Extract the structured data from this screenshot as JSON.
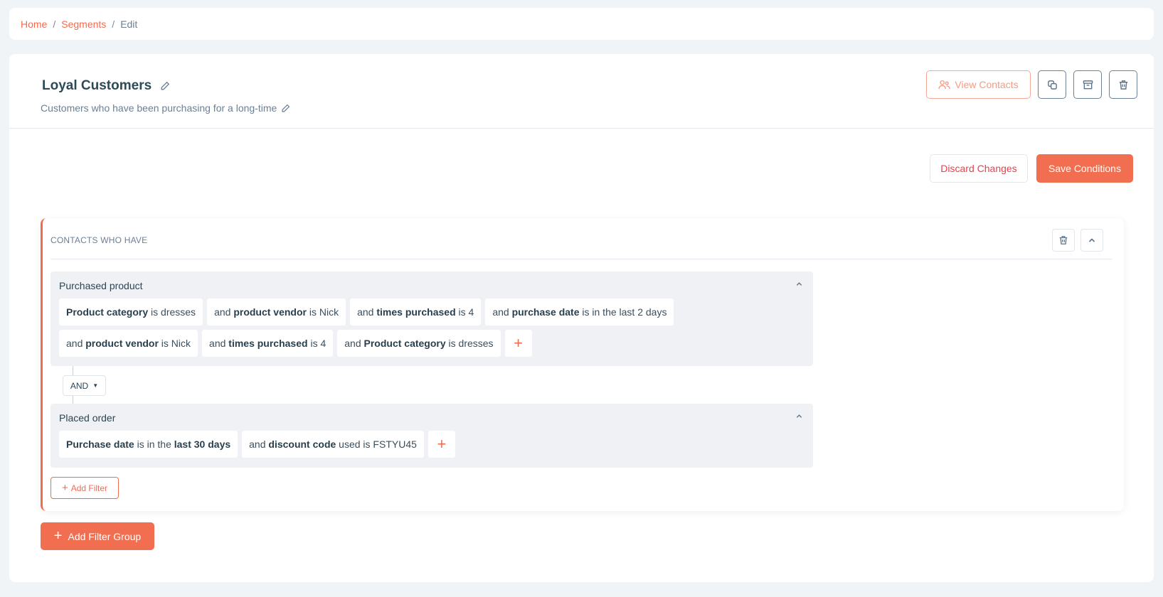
{
  "breadcrumb": [
    {
      "label": "Home"
    },
    {
      "label": "Segments"
    },
    {
      "label": "Edit"
    }
  ],
  "segment": {
    "title": "Loyal Customers",
    "description": "Customers who have been purchasing for a long-time"
  },
  "header_actions": {
    "view_contacts": "View Contacts",
    "icons": [
      "duplicate-icon",
      "archive-icon",
      "trash-icon"
    ]
  },
  "actions": {
    "discard": "Discard Changes",
    "save": "Save Conditions"
  },
  "filter_group": {
    "label": "CONTACTS WHO HAVE",
    "blocks": [
      {
        "title": "Purchased product",
        "chips": [
          [
            {
              "t": "Product category",
              "b": true
            },
            {
              "t": " is dresses"
            }
          ],
          [
            {
              "t": "and "
            },
            {
              "t": "product vendor",
              "b": true
            },
            {
              "t": " is Nick"
            }
          ],
          [
            {
              "t": "and "
            },
            {
              "t": "times purchased",
              "b": true
            },
            {
              "t": " is 4"
            }
          ],
          [
            {
              "t": "and "
            },
            {
              "t": "purchase date",
              "b": true
            },
            {
              "t": " is in the last 2 days"
            }
          ],
          [
            {
              "t": "and "
            },
            {
              "t": "product vendor",
              "b": true
            },
            {
              "t": " is Nick"
            }
          ],
          [
            {
              "t": "and "
            },
            {
              "t": "times purchased",
              "b": true
            },
            {
              "t": " is 4"
            }
          ],
          [
            {
              "t": "and "
            },
            {
              "t": "Product category",
              "b": true
            },
            {
              "t": " is dresses"
            }
          ]
        ]
      },
      {
        "title": "Placed order",
        "chips": [
          [
            {
              "t": "Purchase date",
              "b": true
            },
            {
              "t": " is in the "
            },
            {
              "t": "last 30 days",
              "b": true
            }
          ],
          [
            {
              "t": "and "
            },
            {
              "t": "discount code",
              "b": true
            },
            {
              "t": " used is FSTYU45"
            }
          ]
        ]
      }
    ],
    "operator": "AND",
    "add_chip": "+",
    "add_filter": "Add Filter"
  },
  "add_filter_group": "Add Filter Group",
  "colors": {
    "accent": "#f26b4f",
    "text": "#2d4453",
    "muted": "#6b7f93",
    "block_bg": "#eff1f5",
    "page_bg": "#f1f4f7"
  }
}
